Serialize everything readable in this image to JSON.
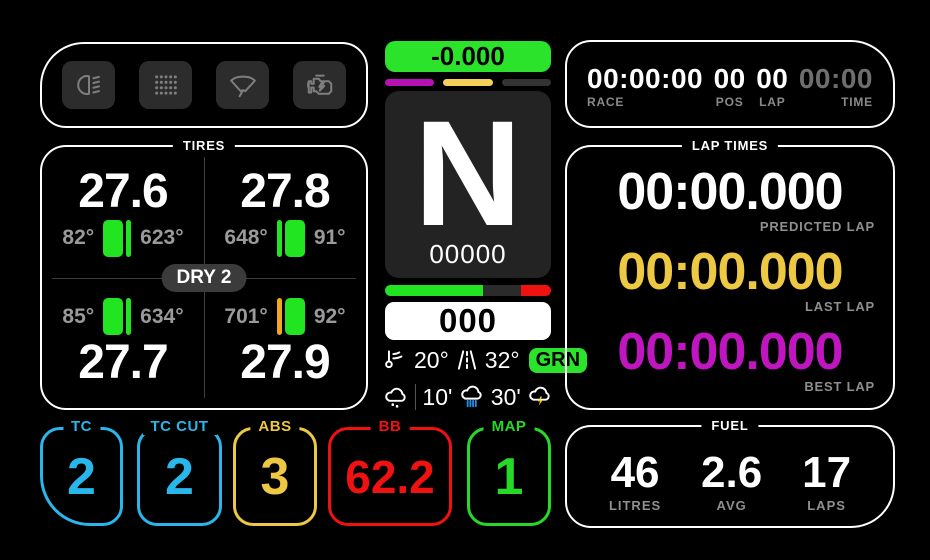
{
  "colors": {
    "green": "#22e522",
    "flag_green": "#2ce32c",
    "blue": "#29b6ea",
    "yellow": "#ecc843",
    "red": "#f01111",
    "purple": "#c016c0",
    "orange": "#f2a71b",
    "label_grey": "#8f8f8f",
    "delta_bg": "#2ce32c",
    "rain_blue": "#1f8fe8",
    "bolt_yellow": "#ffd21f"
  },
  "icon_buttons": [
    {
      "name": "headlight"
    },
    {
      "name": "rain-light"
    },
    {
      "name": "wiper"
    },
    {
      "name": "engine"
    }
  ],
  "tires": {
    "title": "TIRES",
    "badge": "DRY 2",
    "fl": {
      "value": "27.6",
      "left_temp": "82°",
      "right_temp": "623°"
    },
    "fr": {
      "value": "27.8",
      "left_temp": "648°",
      "right_temp": "91°"
    },
    "rl": {
      "value": "27.7",
      "left_temp": "85°",
      "right_temp": "634°"
    },
    "rr": {
      "value": "27.9",
      "left_temp": "701°",
      "right_temp": "92°"
    }
  },
  "gear": {
    "delta": "-0.000",
    "gear": "N",
    "odometer": "00000",
    "speed": "000"
  },
  "weather": {
    "air_temp": "20°",
    "track_temp": "32°",
    "flag": "GRN",
    "forecast_10": "10'",
    "forecast_30": "30'"
  },
  "race": {
    "race": {
      "value": "00:00:00",
      "label": "RACE"
    },
    "pos": {
      "value": "00",
      "label": "POS"
    },
    "lap": {
      "value": "00",
      "label": "LAP"
    },
    "time": {
      "value": "00:00",
      "label": "TIME"
    }
  },
  "lap_times": {
    "title": "LAP TIMES",
    "predicted": {
      "value": "00:00.000",
      "label": "PREDICTED LAP"
    },
    "last": {
      "value": "00:00.000",
      "label": "LAST LAP"
    },
    "best": {
      "value": "00:00.000",
      "label": "BEST LAP"
    }
  },
  "controls": {
    "tc": {
      "label": "TC",
      "value": "2"
    },
    "tc_cut": {
      "label": "TC CUT",
      "value": "2"
    },
    "abs": {
      "label": "ABS",
      "value": "3"
    },
    "bb": {
      "label": "BB",
      "value": "62.2"
    },
    "map": {
      "label": "MAP",
      "value": "1"
    }
  },
  "fuel": {
    "title": "FUEL",
    "litres": {
      "value": "46",
      "label": "LITRES"
    },
    "avg": {
      "value": "2.6",
      "label": "AVG"
    },
    "laps": {
      "value": "17",
      "label": "LAPS"
    }
  }
}
